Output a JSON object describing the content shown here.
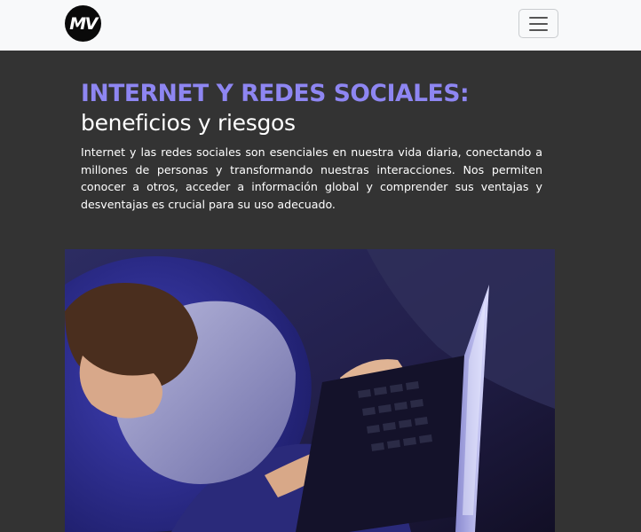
{
  "navbar": {
    "logo_text": "MV",
    "menu_toggle_icon": "hamburger-menu-icon"
  },
  "main": {
    "headline": "INTERNET Y REDES SOCIALES:",
    "subheadline": "beneficios y riesgos",
    "intro": "Internet y las redes sociales son esenciales en nuestra vida diaria, conectando a millones de personas y transformando nuestras interacciones. Nos permiten conocer a otros, acceder a información global y comprender sus ventajas y desventajas es crucial para su uso adecuado.",
    "hero_image": "child-using-laptop-photo"
  },
  "colors": {
    "navbar_bg": "#f8f9fa",
    "page_bg": "#333333",
    "headline": "#8e86f2",
    "text": "#ffffff"
  }
}
